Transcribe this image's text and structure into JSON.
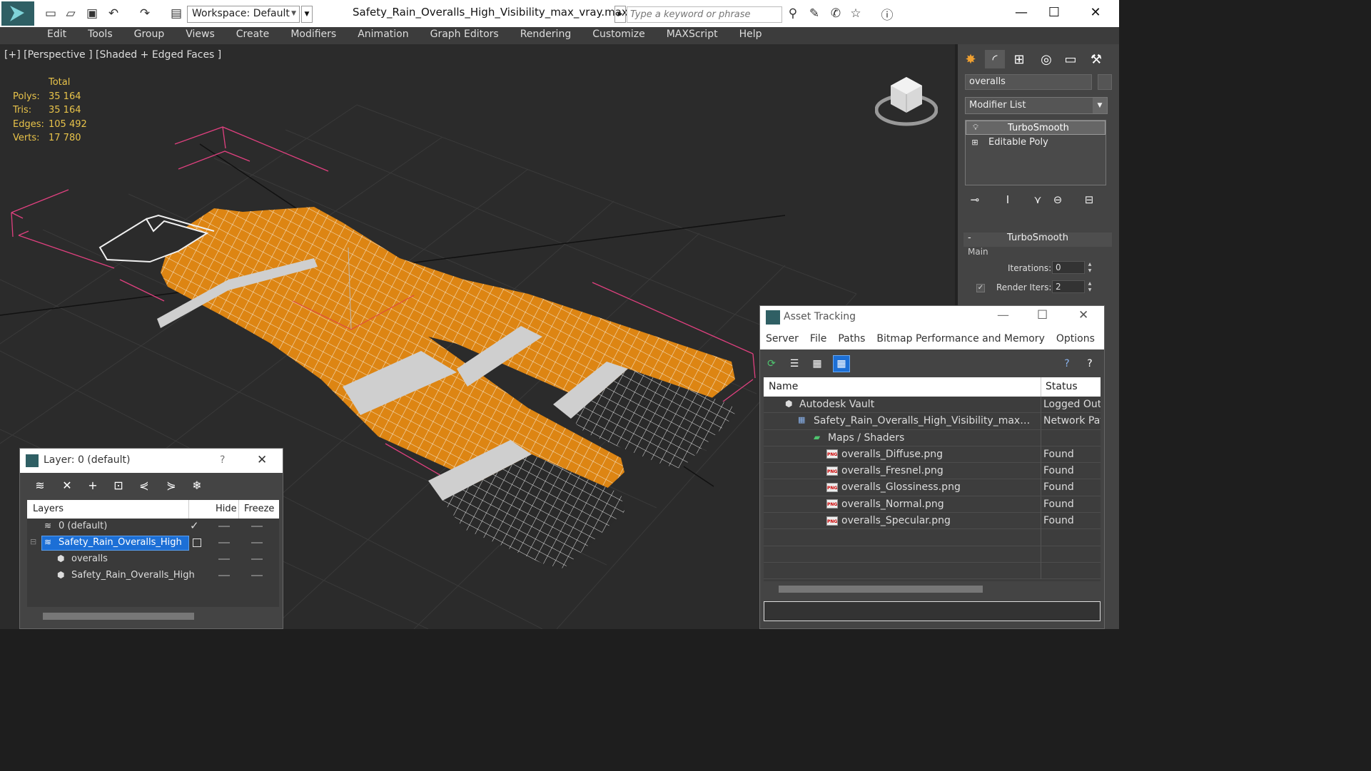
{
  "titlebar": {
    "workspace_label": "Workspace: Default",
    "filename": "Safety_Rain_Overalls_High_Visibility_max_vray.max",
    "search_placeholder": "Type a keyword or phrase"
  },
  "menu": [
    "Edit",
    "Tools",
    "Group",
    "Views",
    "Create",
    "Modifiers",
    "Animation",
    "Graph Editors",
    "Rendering",
    "Customize",
    "MAXScript",
    "Help"
  ],
  "viewport": {
    "label": "[+] [Perspective ] [Shaded + Edged Faces ]",
    "stats": {
      "header": "Total",
      "rows": [
        {
          "k": "Polys:",
          "v": "35 164"
        },
        {
          "k": "Tris:",
          "v": "35 164"
        },
        {
          "k": "Edges:",
          "v": "105 492"
        },
        {
          "k": "Verts:",
          "v": "17 780"
        }
      ]
    }
  },
  "command_panel": {
    "object_name": "overalls",
    "modifier_list": "Modifier List",
    "stack": [
      "TurboSmooth",
      "Editable Poly"
    ],
    "rollout_title": "TurboSmooth",
    "group_main": "Main",
    "iterations_label": "Iterations:",
    "iterations_value": "0",
    "render_iters_label": "Render Iters:",
    "render_iters_value": "2"
  },
  "layer_window": {
    "title": "Layer: 0 (default)",
    "help": "?",
    "columns": {
      "layers": "Layers",
      "hide": "Hide",
      "freeze": "Freeze"
    },
    "rows": [
      "0 (default)",
      "Safety_Rain_Overalls_High",
      "overalls",
      "Safety_Rain_Overalls_High"
    ]
  },
  "asset_tracking": {
    "title": "Asset Tracking",
    "menu": [
      "Server",
      "File",
      "Paths",
      "Bitmap Performance and Memory",
      "Options"
    ],
    "columns": {
      "name": "Name",
      "status": "Status"
    },
    "rows": [
      {
        "name": "Autodesk Vault",
        "status": "Logged Out"
      },
      {
        "name": "Safety_Rain_Overalls_High_Visibility_max_vray...",
        "status": "Network Pat"
      },
      {
        "name": "Maps / Shaders",
        "status": ""
      },
      {
        "name": "overalls_Diffuse.png",
        "status": "Found"
      },
      {
        "name": "overalls_Fresnel.png",
        "status": "Found"
      },
      {
        "name": "overalls_Glossiness.png",
        "status": "Found"
      },
      {
        "name": "overalls_Normal.png",
        "status": "Found"
      },
      {
        "name": "overalls_Specular.png",
        "status": "Found"
      }
    ]
  },
  "colors": {
    "orange": "#dd8513",
    "stripe": "#cfcfcf",
    "cuff": "#2a2a2a",
    "bbox": "#e0407f",
    "selection": "#1c6fd6",
    "stats_text": "#e8c34a"
  }
}
